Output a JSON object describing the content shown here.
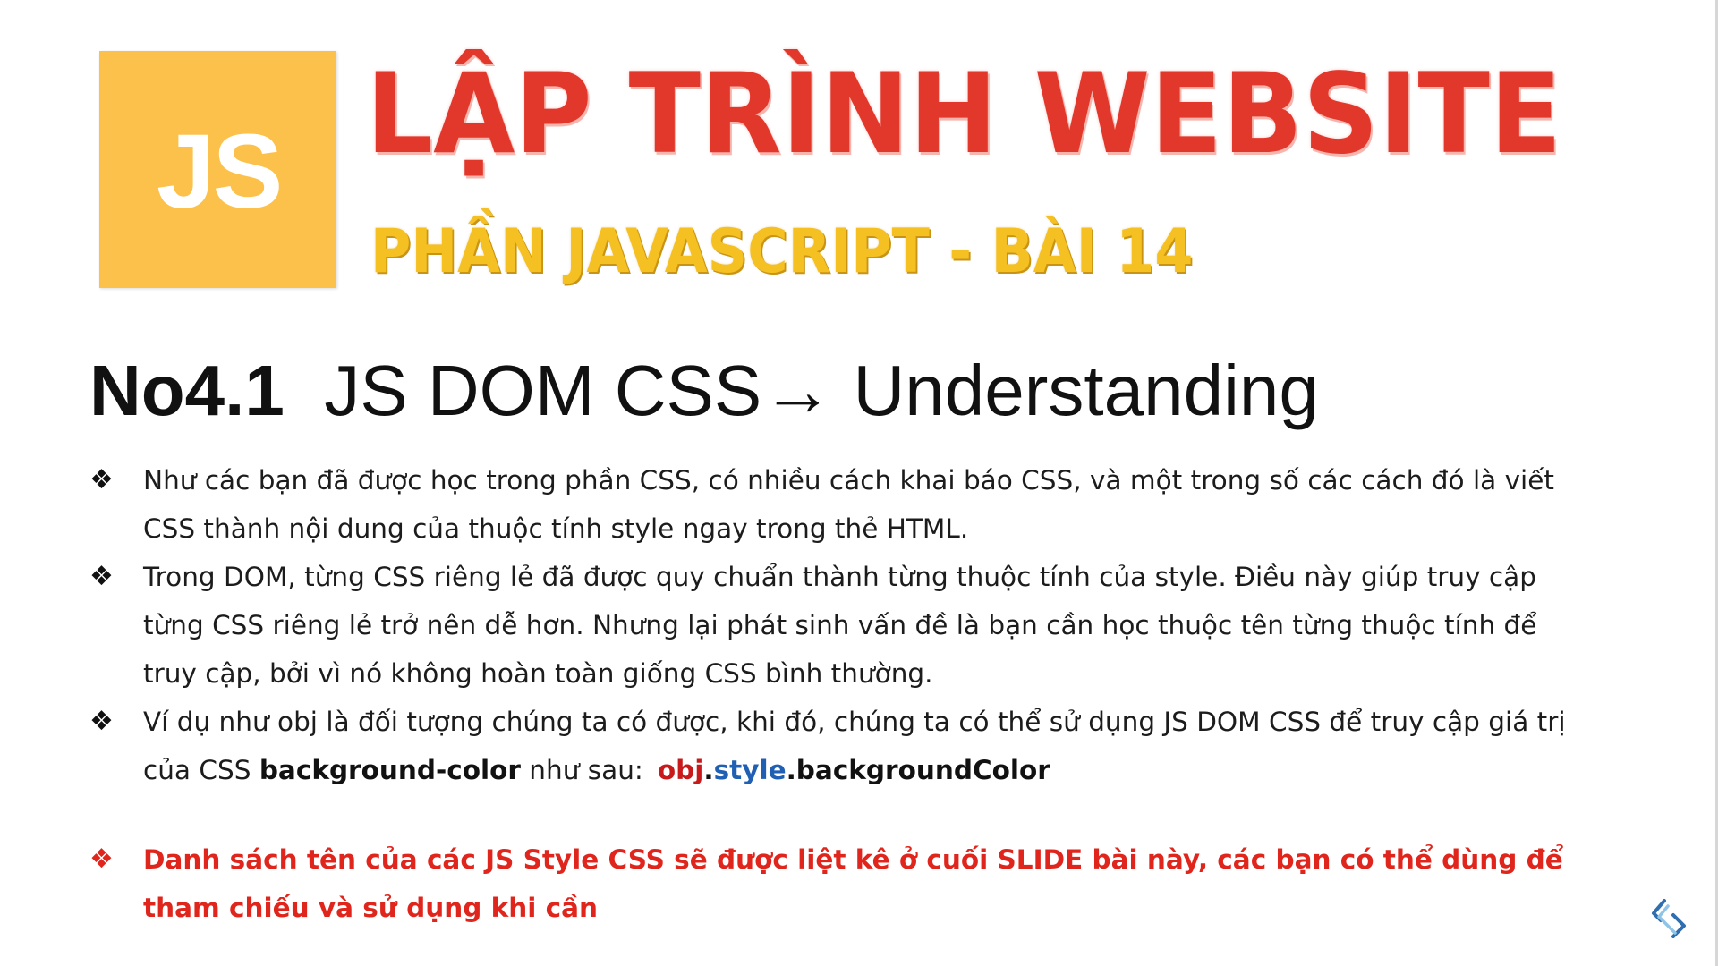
{
  "logo": {
    "text": "JS",
    "background": "#fcc14b"
  },
  "title": {
    "main": "LẬP TRÌNH WEBSITE",
    "sub": "PHẦN JAVASCRIPT - BÀI 14",
    "main_color": "#e2382c",
    "sub_color": "#f5c022"
  },
  "heading": {
    "number": "No4.1",
    "text": "JS DOM CSS",
    "arrow": "→",
    "tail": "Understanding"
  },
  "bullets": [
    {
      "icon": "❖",
      "text": "Như các bạn đã được học trong phần CSS, có nhiều cách khai báo CSS, và một trong số các cách đó là viết CSS thành nội dung của thuộc tính style ngay trong thẻ HTML."
    },
    {
      "icon": "❖",
      "text": "Trong DOM, từng CSS riêng lẻ đã được quy chuẩn thành từng thuộc tính của style. Điều này giúp truy cập từng CSS riêng lẻ trở nên dễ hơn. Nhưng lại phát sinh vấn đề là bạn cần học thuộc tên từng thuộc tính để truy cập, bởi vì nó không hoàn toàn giống CSS bình thường."
    },
    {
      "icon": "❖",
      "text_before": "Ví dụ như obj là đối tượng chúng ta có được, khi đó, chúng ta có thể sử dụng JS DOM CSS để truy cập giá trị của CSS ",
      "css_prop": "background-color",
      "text_after": " như sau:",
      "code_obj": "obj",
      "code_dot1": ".",
      "code_style": "style",
      "code_prop": ".backgroundColor"
    },
    {
      "icon": "❖",
      "text": "Danh sách tên của các JS Style CSS sẽ được liệt kê ở cuối SLIDE bài này, các bạn có thể dùng để tham chiếu và sử dụng khi cần",
      "color": "#e0261c"
    }
  ],
  "corner_icon": "brand-logo-icon"
}
